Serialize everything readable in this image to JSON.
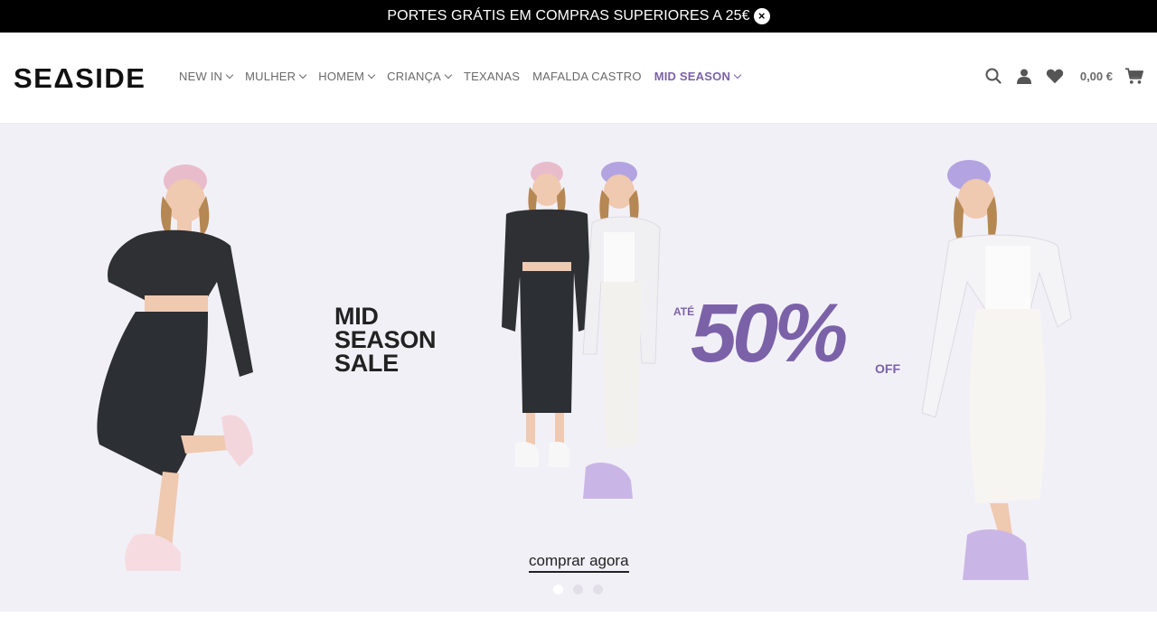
{
  "promo": {
    "text": "PORTES GRÁTIS EM COMPRAS SUPERIORES A 25€",
    "close_icon": "close-icon"
  },
  "header": {
    "logo": "SEΔSIDE",
    "nav": [
      {
        "label": "NEW IN",
        "dropdown": true
      },
      {
        "label": "MULHER",
        "dropdown": true
      },
      {
        "label": "HOMEM",
        "dropdown": true
      },
      {
        "label": "CRIANÇA",
        "dropdown": true
      },
      {
        "label": "TEXANAS",
        "dropdown": false
      },
      {
        "label": "MAFALDA CASTRO",
        "dropdown": false
      },
      {
        "label": "MID SEASON",
        "dropdown": true,
        "active": true
      }
    ],
    "icons": [
      "search-icon",
      "account-icon",
      "wishlist-icon",
      "cart-icon"
    ],
    "cart_total": "0,00 €"
  },
  "hero": {
    "headline": [
      "MID",
      "SEASON",
      "SALE"
    ],
    "ate": "ATÉ",
    "discount": "50%",
    "off": "OFF",
    "cta": "comprar agora",
    "slides": 3,
    "active_slide": 1
  },
  "colors": {
    "accent": "#7b62a8",
    "promo_bg": "#000000",
    "hero_bg": "#f2f0f7"
  }
}
